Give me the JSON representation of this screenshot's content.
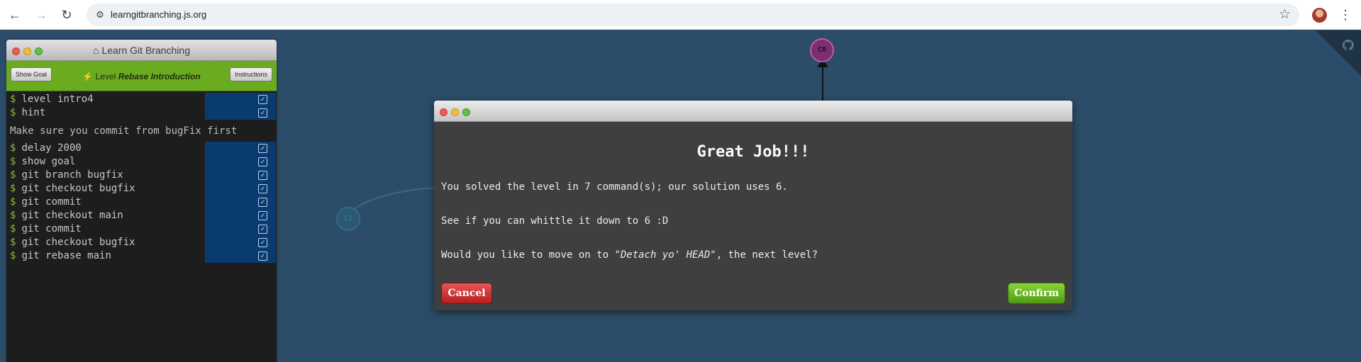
{
  "browser": {
    "url": "learngitbranching.js.org"
  },
  "panel": {
    "title": "Learn Git Branching",
    "show_goal": "Show Goal",
    "instructions": "Instructions",
    "level_prefix": "Level",
    "level_name": "Rebase Introduction",
    "commands_top": [
      "level intro4",
      "hint"
    ],
    "hint": "Make sure you commit from bugFix first",
    "commands": [
      "delay 2000",
      "show goal",
      "git branch bugfix",
      "git checkout bugfix",
      "git commit",
      "git checkout main",
      "git commit",
      "git checkout bugfix",
      "git rebase main"
    ]
  },
  "graph": {
    "root_commit": "C0",
    "faded_commit": "C2"
  },
  "dialog": {
    "heading": "Great Job!!!",
    "solved": "You solved the level in 7 command(s); our solution uses 6.",
    "whittle": "See if you can whittle it down to 6 :D",
    "move_on_prefix": "Would you like to move on to ",
    "next_level": "\"Detach yo' HEAD\"",
    "move_on_suffix": ", the next level?",
    "cancel": "Cancel",
    "confirm": "Confirm"
  }
}
